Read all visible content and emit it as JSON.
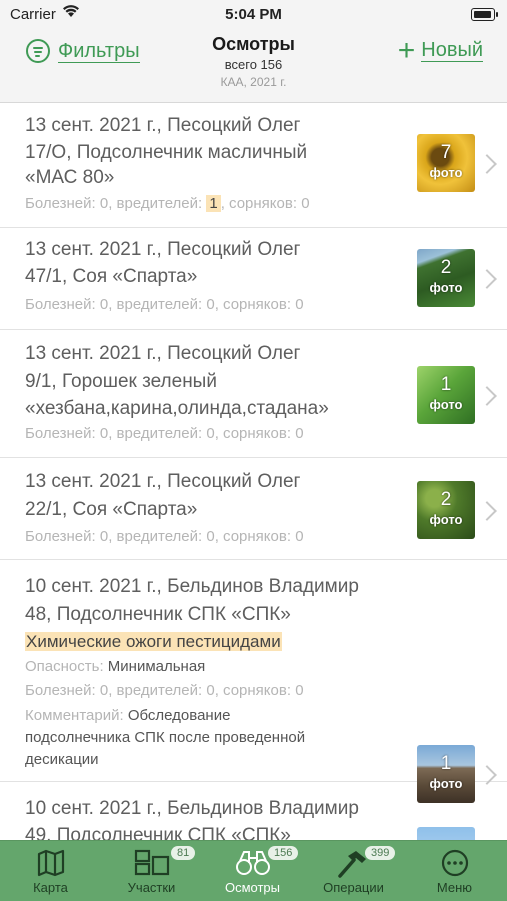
{
  "status": {
    "carrier": "Carrier",
    "time": "5:04 PM"
  },
  "nav": {
    "filters_label": "Фильтры",
    "title": "Осмотры",
    "subtitle": "всего 156",
    "subtitle2": "КАА, 2021 г.",
    "new_label": "Новый"
  },
  "counters": {
    "diseases_label": "Болезней:",
    "pests_label": "вредителей:",
    "weeds_label": "сорняков:",
    "danger_label": "Опасность:",
    "comment_label": "Комментарий:",
    "photo_label": "фото"
  },
  "inspections": [
    {
      "date": "13 сент. 2021 г.,",
      "person": "Песоцкий Олег",
      "field": "17/О,",
      "crop": "Подсолнечник масличный",
      "crop2": "«МАС 80»",
      "diseases": "0",
      "pests": "1",
      "weeds": "0",
      "photos": "7"
    },
    {
      "date": "13 сент. 2021 г.,",
      "person": "Песоцкий Олег",
      "field": "47/1,",
      "crop": "Соя «Спарта»",
      "diseases": "0",
      "pests": "0",
      "weeds": "0",
      "photos": "2"
    },
    {
      "date": "13 сент. 2021 г.,",
      "person": "Песоцкий Олег",
      "field": "9/1,",
      "crop": " Горошек зеленый",
      "crop2": "«хезбана,карина,олинда,стадана»",
      "diseases": "0",
      "pests": "0",
      "weeds": "0",
      "photos": "1"
    },
    {
      "date": "13 сент. 2021 г.,",
      "person": "Песоцкий Олег",
      "field": "22/1,",
      "crop": "Соя «Спарта»",
      "diseases": "0",
      "pests": "0",
      "weeds": "0",
      "photos": "2"
    },
    {
      "date": "10 сент. 2021 г.,",
      "person": "Бельдинов Владимир",
      "field": "48,",
      "crop": "Подсолнечник СПК «СПК»",
      "problem": "Химические ожоги пестицидами",
      "danger": "Минимальная",
      "diseases": "0",
      "pests": "0",
      "weeds": "0",
      "comment": "Обследование",
      "comment2": "подсолнечника СПК  после проведенной",
      "comment3": "десикации",
      "photos": "1"
    },
    {
      "date": "10 сент. 2021 г.,",
      "person": "Бельдинов Владимир",
      "field": "49,",
      "crop": "Подсолнечник СПК «СПК»"
    }
  ],
  "tabs": [
    {
      "label": "Карта",
      "icon": "map-icon"
    },
    {
      "label": "Участки",
      "icon": "fields-icon",
      "badge": "81"
    },
    {
      "label": "Осмотры",
      "icon": "binoculars-icon",
      "badge": "156",
      "active": true
    },
    {
      "label": "Операции",
      "icon": "hammer-icon",
      "badge": "399"
    },
    {
      "label": "Меню",
      "icon": "more-icon"
    }
  ],
  "colors": {
    "accent": "#3f9a55",
    "tabbar": "#64a66c",
    "highlight": "#fbe3b6"
  }
}
